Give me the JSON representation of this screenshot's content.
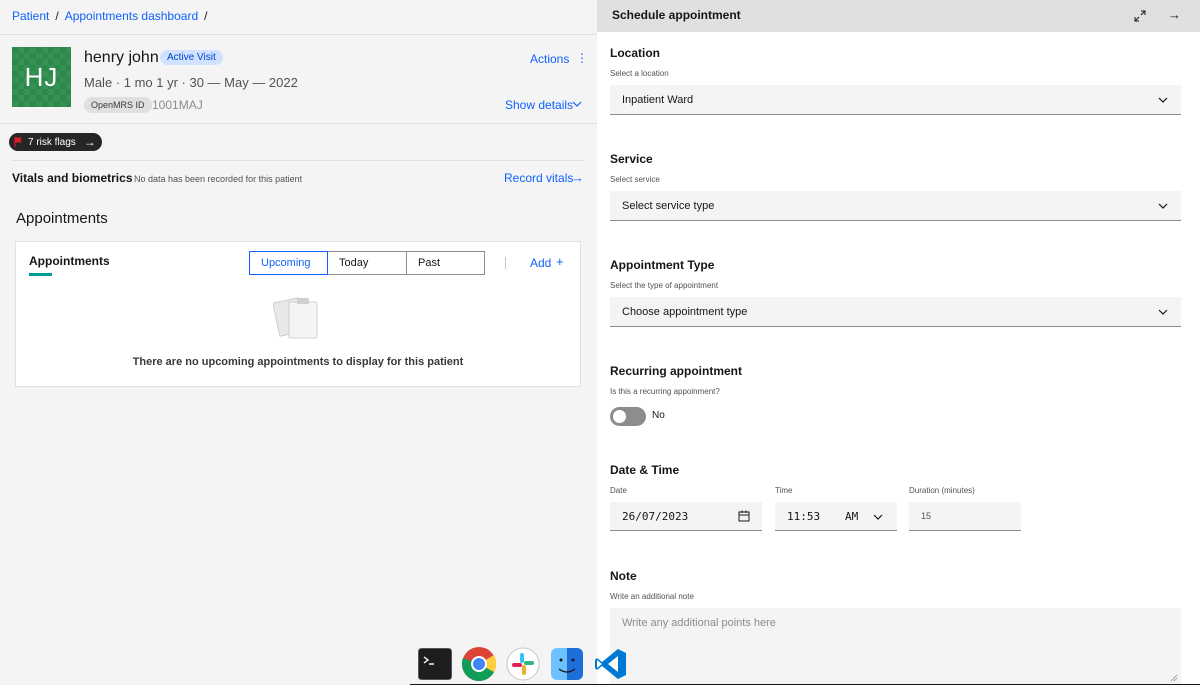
{
  "breadcrumb": {
    "items": [
      "Patient",
      "Appointments dashboard"
    ],
    "separator": "/"
  },
  "patient": {
    "initials": "HJ",
    "name": "henry john",
    "visit_badge": "Active Visit",
    "demographics": "Male · 1 mo 1 yr · 30 — May — 2022",
    "id_label": "OpenMRS ID",
    "id_value": "1001MAJ",
    "actions_label": "Actions",
    "show_details_label": "Show details",
    "avatar_color": "#2b8a4a"
  },
  "risk_flags": {
    "label": "7 risk flags"
  },
  "vitals": {
    "title": "Vitals and biometrics",
    "subtitle": "No data has been recorded for this patient",
    "record_label": "Record vitals"
  },
  "appointments": {
    "heading": "Appointments",
    "card_title": "Appointments",
    "tabs": [
      "Upcoming",
      "Today",
      "Past"
    ],
    "active_tab": "Upcoming",
    "add_label": "Add",
    "empty_message": "There are no upcoming appointments to display for this patient"
  },
  "panel": {
    "title": "Schedule appointment",
    "location": {
      "title": "Location",
      "subtitle": "Select a location",
      "value": "Inpatient Ward"
    },
    "service": {
      "title": "Service",
      "subtitle": "Select service",
      "value": "Select service type"
    },
    "appointment_type": {
      "title": "Appointment Type",
      "subtitle": "Select the type of appointment",
      "value": "Choose appointment type"
    },
    "recurring": {
      "title": "Recurring appointment",
      "subtitle": "Is this a recurring appoinment?",
      "toggle_label": "No",
      "enabled": false
    },
    "datetime": {
      "title": "Date & Time",
      "date_label": "Date",
      "date_value": "26/07/2023",
      "time_label": "Time",
      "time_value": "11:53",
      "ampm": "AM",
      "duration_label": "Duration (minutes)",
      "duration_value": "15"
    },
    "note": {
      "title": "Note",
      "subtitle": "Write an additional note",
      "placeholder": "Write any additional points here"
    }
  },
  "dock": {
    "apps": [
      "terminal-icon",
      "chrome-icon",
      "slack-icon",
      "finder-icon",
      "vscode-icon"
    ]
  },
  "colors": {
    "link": "#0f62fe",
    "accent_teal": "#009d9a",
    "panel_bg": "#ffffff",
    "page_bg": "#f4f4f4"
  }
}
